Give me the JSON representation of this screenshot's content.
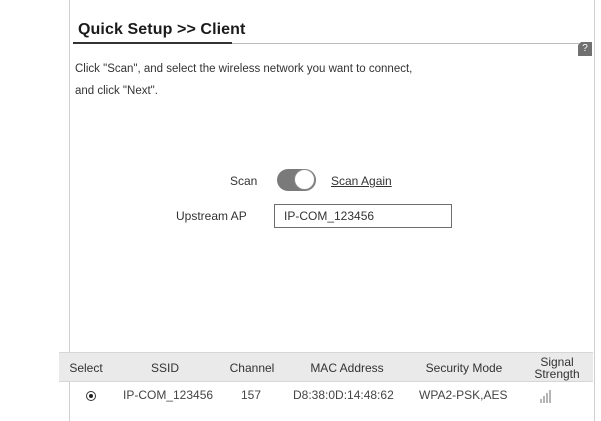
{
  "header": {
    "title": "Quick Setup >> Client",
    "help_label": "?"
  },
  "instructions": {
    "line1": "Click \"Scan\", and select the wireless network you want to connect,",
    "line2": "and click \"Next\"."
  },
  "scan": {
    "label": "Scan",
    "toggle_on": true,
    "scan_again_label": "Scan Again"
  },
  "upstream": {
    "label": "Upstream AP",
    "value": "IP-COM_123456"
  },
  "table": {
    "headers": {
      "select": "Select",
      "ssid": "SSID",
      "channel": "Channel",
      "mac": "MAC Address",
      "security": "Security Mode",
      "signal_line1": "Signal",
      "signal_line2": "Strength"
    },
    "rows": [
      {
        "selected": true,
        "ssid": "IP-COM_123456",
        "channel": "157",
        "mac": "D8:38:0D:14:48:62",
        "security": "WPA2-PSK,AES",
        "signal_icon": "signal-bars-icon"
      }
    ]
  },
  "colors": {
    "toggle_track": "#7a7a7a",
    "table_header_bg": "#eaeaea",
    "help_icon_bg": "#707070"
  }
}
